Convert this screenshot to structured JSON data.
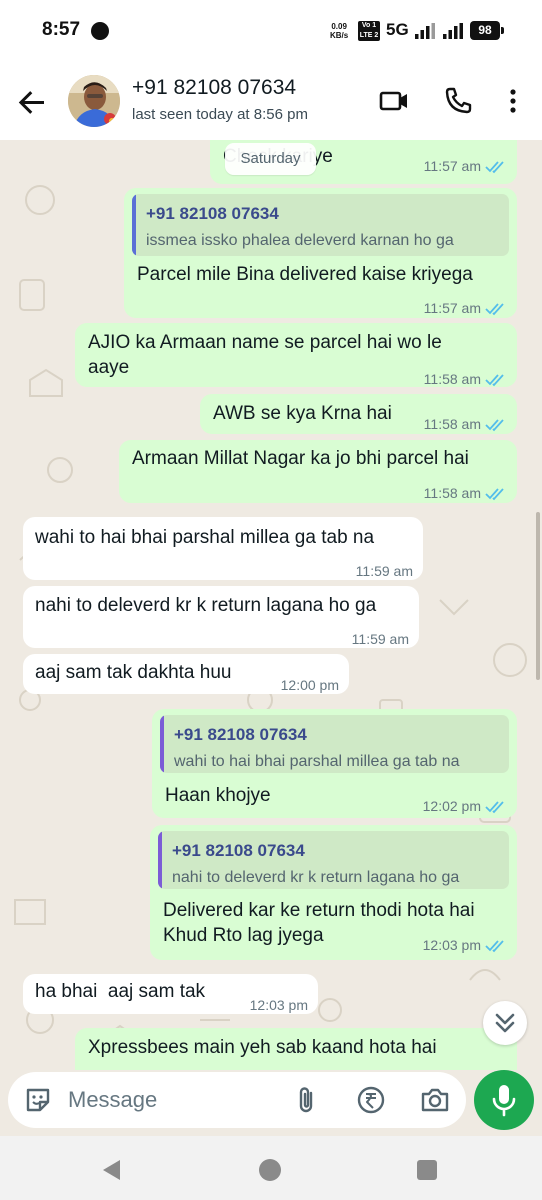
{
  "status_bar": {
    "time": "8:57",
    "net_speed_value": "0.09",
    "net_speed_unit": "KB/s",
    "volte_top": "Vo 1",
    "volte_bottom": "LTE 2",
    "network_type": "5G",
    "battery": "98"
  },
  "header": {
    "contact_name": "+91 82108 07634",
    "last_seen": "last seen today at 8:56 pm",
    "icons": [
      "back-arrow-icon",
      "video-call-icon",
      "voice-call-icon",
      "more-vert-icon"
    ]
  },
  "date_chip": "Saturday",
  "messages": [
    {
      "dir": "out",
      "text": "Check kariye",
      "time": "11:57 am",
      "ticks": "read"
    },
    {
      "dir": "out",
      "quote_author": "+91 82108 07634",
      "quote_text": "issmea issko phalea deleverd karnan ho ga",
      "text": "Parcel mile Bina delivered kaise kriyega",
      "time": "11:57 am",
      "ticks": "read"
    },
    {
      "dir": "out",
      "text": "AJIO ka Armaan name se parcel hai wo le\naaye",
      "time": "11:58 am",
      "ticks": "read"
    },
    {
      "dir": "out",
      "text": "AWB se kya Krna hai",
      "time": "11:58 am",
      "ticks": "read"
    },
    {
      "dir": "out",
      "text": "Armaan Millat Nagar ka jo bhi parcel hai",
      "time": "11:58 am",
      "ticks": "read"
    },
    {
      "dir": "in",
      "text": "wahi to hai bhai parshal millea ga tab na",
      "time": "11:59 am"
    },
    {
      "dir": "in",
      "text": "nahi to deleverd kr k return lagana ho ga",
      "time": "11:59 am"
    },
    {
      "dir": "in",
      "text": "aaj sam tak dakhta huu",
      "time": "12:00 pm"
    },
    {
      "dir": "out",
      "quote_author": "+91 82108 07634",
      "quote_text": "wahi to hai bhai parshal millea ga tab na",
      "text": "Haan khojye",
      "time": "12:02 pm",
      "ticks": "read"
    },
    {
      "dir": "out",
      "quote_author": "+91 82108 07634",
      "quote_text": "nahi to deleverd kr k return lagana ho ga",
      "text": "Delivered kar ke return thodi hota hai\nKhud Rto lag jyega",
      "time": "12:03 pm",
      "ticks": "read"
    },
    {
      "dir": "in",
      "text": "ha bhai  aaj sam tak",
      "time": "12:03 pm"
    },
    {
      "dir": "out",
      "text": "Xpressbees main yeh sab kaand hota hai"
    }
  ],
  "composer": {
    "placeholder": "Message",
    "icons": [
      "sticker-icon",
      "attach-icon",
      "rupee-payment-icon",
      "camera-icon"
    ],
    "mic_icon": "mic-icon"
  },
  "colors": {
    "outgoing_bubble": "#d9fdd3",
    "incoming_bubble": "#ffffff",
    "read_ticks": "#53bdeb",
    "accent_green": "#1da851",
    "chat_background": "#efeae2"
  }
}
